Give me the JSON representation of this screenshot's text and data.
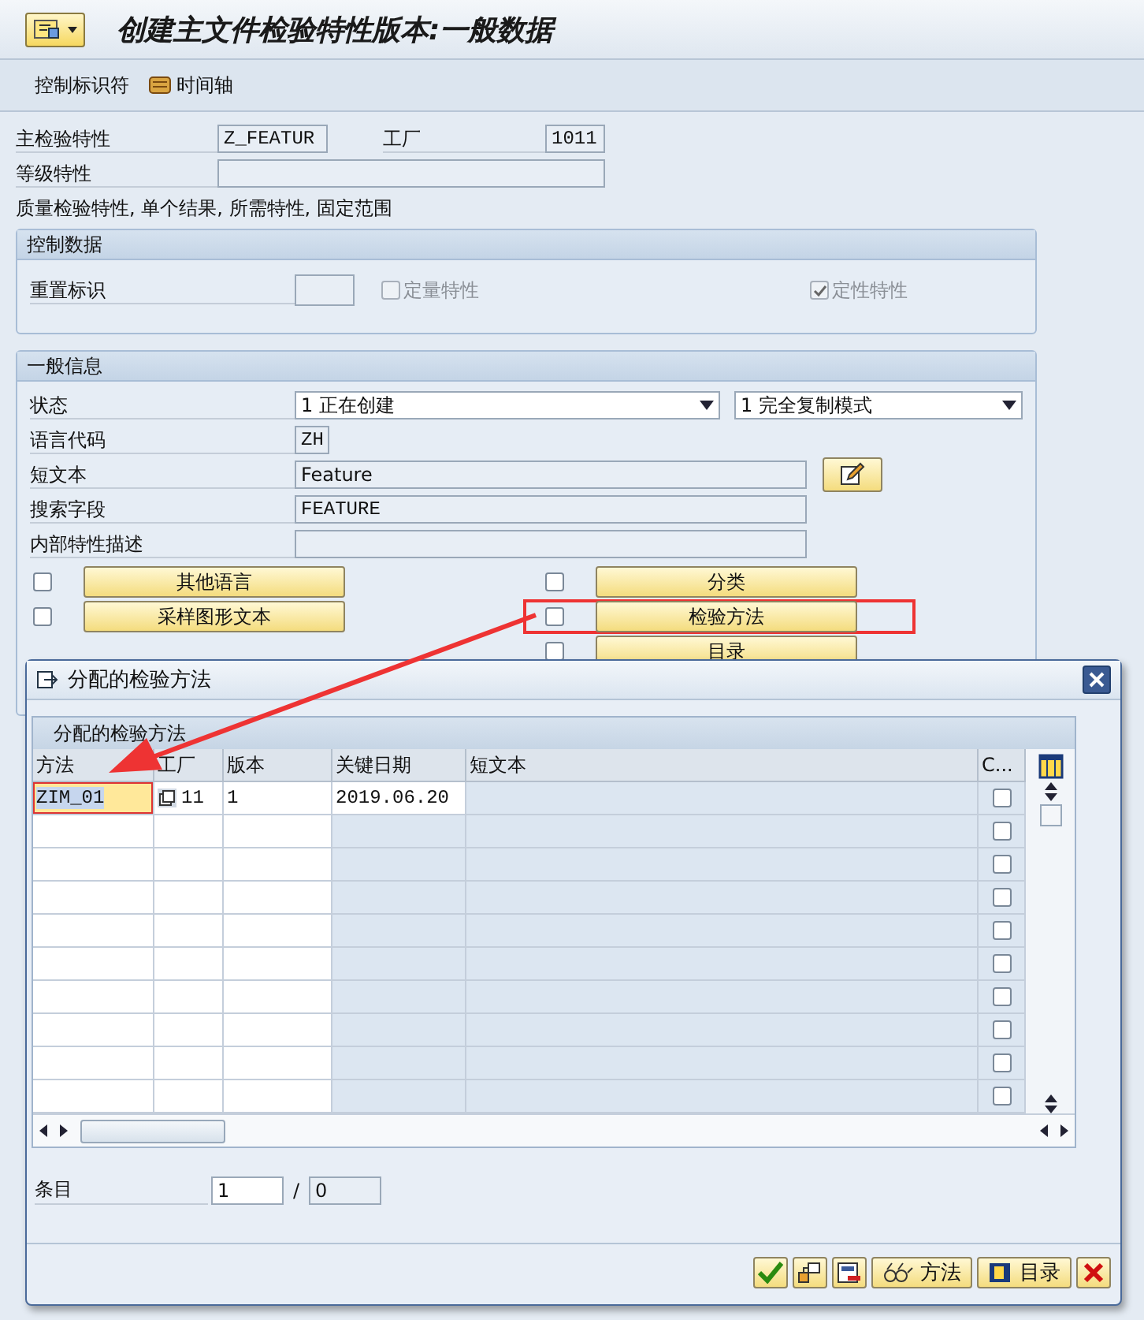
{
  "window": {
    "title": "创建主文件检验特性版本:一般数据"
  },
  "toolbar": [
    {
      "kind": "text",
      "label": "控制标识符"
    },
    {
      "kind": "timeline",
      "label": "时间轴"
    }
  ],
  "header": {
    "characteristic": {
      "label": "主检验特性",
      "value": "Z_FEATUR"
    },
    "plant": {
      "label": "工厂",
      "value": "1011"
    },
    "class_char": {
      "label": "等级特性"
    },
    "description": "质量检验特性, 单个结果, 所需特性, 固定范围"
  },
  "control_data": {
    "title": "控制数据",
    "reset_label": "重置标识",
    "checkboxes": [
      {
        "label": "定量特性",
        "checked": false,
        "disabled": true
      },
      {
        "label": "定性特性",
        "checked": true,
        "disabled": true
      }
    ]
  },
  "general": {
    "title": "一般信息",
    "status": {
      "label": "状态",
      "value": "1 正在创建"
    },
    "copy_mode": {
      "value": "1 完全复制模式"
    },
    "language": {
      "label": "语言代码",
      "value": "ZH"
    },
    "short_text": {
      "label": "短文本",
      "value": "Feature"
    },
    "search_field": {
      "label": "搜索字段",
      "value": "FEATURE"
    },
    "internal_desc": {
      "label": "内部特性描述"
    },
    "buttons": [
      {
        "label": "其他语言",
        "checked": false,
        "highlighted": false
      },
      {
        "label": "采样图形文本",
        "checked": false,
        "highlighted": false
      },
      {
        "label": "分类",
        "checked": false,
        "highlighted": false
      },
      {
        "label": "检验方法",
        "checked": false,
        "highlighted": true
      },
      {
        "label": "目录",
        "checked": false,
        "highlighted": false
      }
    ]
  },
  "dialog": {
    "title": "分配的检验方法",
    "table": {
      "title": "分配的检验方法",
      "columns": [
        "方法",
        "工厂",
        "版本",
        "关键日期",
        "短文本",
        "C..."
      ],
      "rows": [
        {
          "method": "ZIM_01",
          "plant": "11",
          "version": "1",
          "key_date": "2019.06.20",
          "checked": false,
          "selected": true
        },
        {
          "checked": false,
          "selected": false
        },
        {
          "checked": false,
          "selected": false
        },
        {
          "checked": false,
          "selected": false
        },
        {
          "checked": false,
          "selected": false
        },
        {
          "checked": false,
          "selected": false
        },
        {
          "checked": false,
          "selected": false
        },
        {
          "checked": false,
          "selected": false
        },
        {
          "checked": false,
          "selected": false
        },
        {
          "checked": false,
          "selected": false
        }
      ]
    },
    "entry": {
      "label": "条目",
      "current": "1",
      "separator": "/",
      "total": "0"
    },
    "buttons": [
      {
        "kind": "confirm"
      },
      {
        "kind": "hierarchy"
      },
      {
        "kind": "save"
      },
      {
        "kind": "method",
        "label": "方法"
      },
      {
        "kind": "catalog",
        "label": "目录"
      },
      {
        "kind": "cancel"
      }
    ]
  }
}
